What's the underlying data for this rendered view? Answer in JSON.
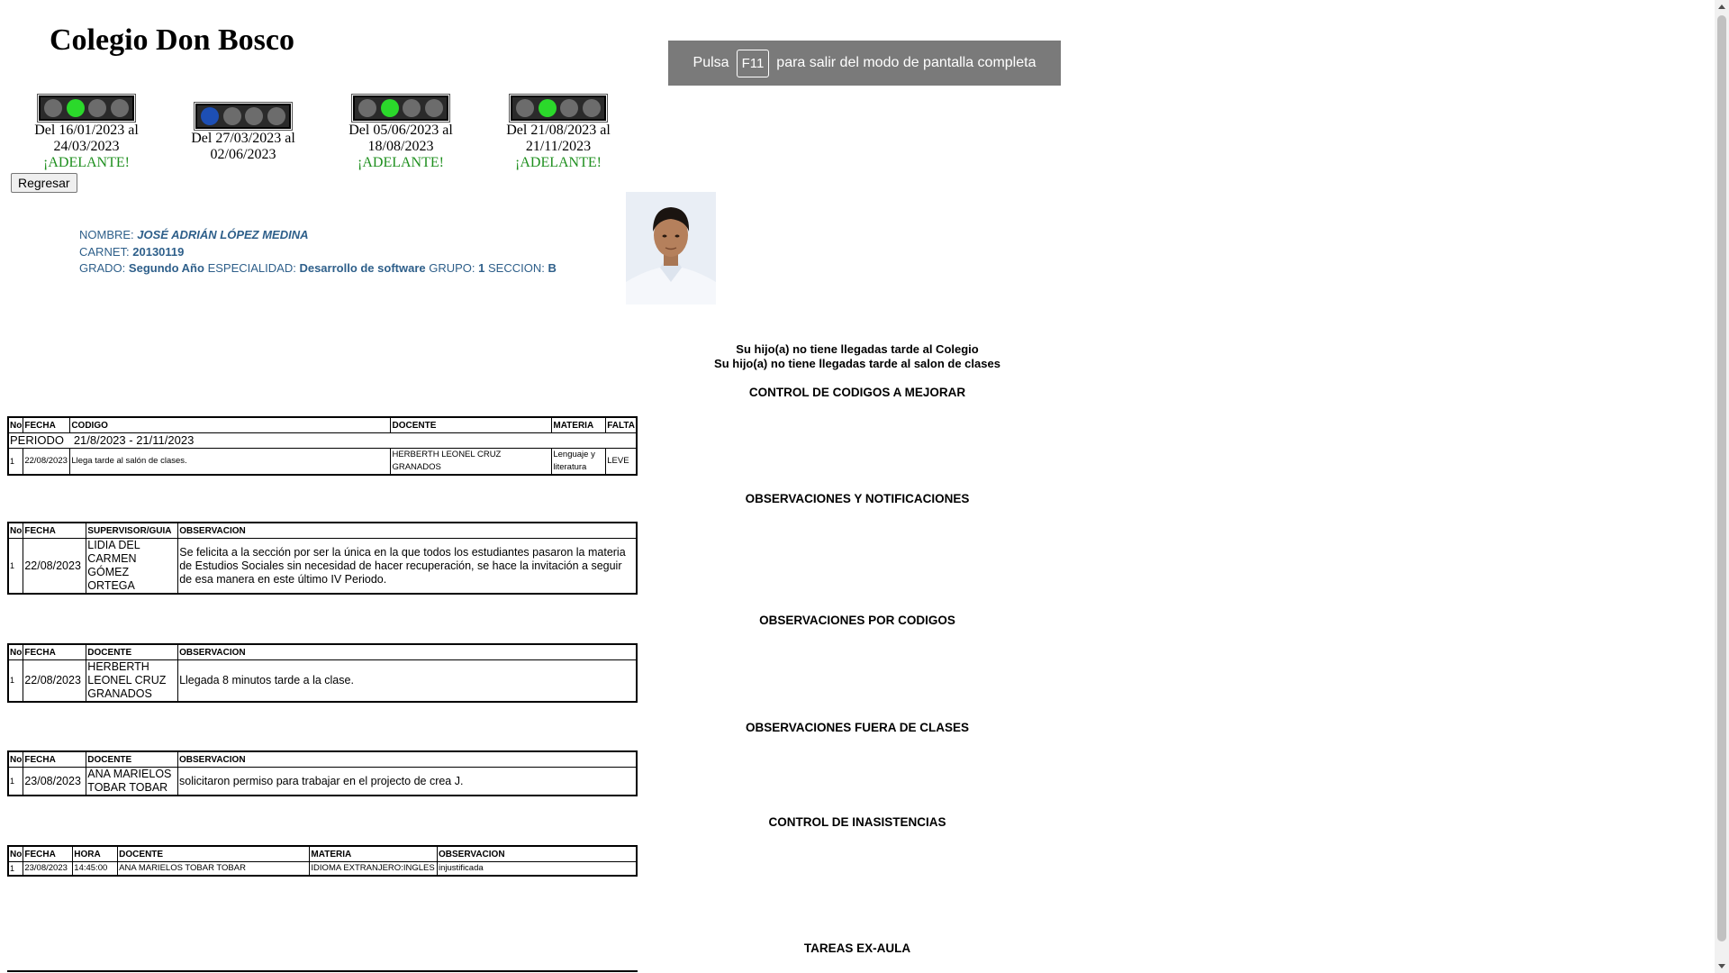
{
  "header": {
    "school_name": "Colegio Don Bosco"
  },
  "fullscreen_banner": {
    "prefix": "Pulsa",
    "key": "F11",
    "suffix": "para salir del modo de pantalla completa"
  },
  "periods": [
    {
      "text": "Del 16/01/2023 al 24/03/2023",
      "status": "¡ADELANTE!",
      "active_light": 2,
      "color": "green"
    },
    {
      "text": "Del 27/03/2023 al 02/06/2023",
      "status": "",
      "active_light": 1,
      "color": "blue"
    },
    {
      "text": "Del 05/06/2023 al 18/08/2023",
      "status": "¡ADELANTE!",
      "active_light": 2,
      "color": "green"
    },
    {
      "text": "Del 21/08/2023 al 21/11/2023",
      "status": "¡ADELANTE!",
      "active_light": 2,
      "color": "green"
    }
  ],
  "back_button": {
    "label": "Regresar"
  },
  "student": {
    "name_label": "NOMBRE:",
    "name": "JOSÉ ADRIÁN LÓPEZ MEDINA",
    "carnet_label": "CARNET:",
    "carnet": "20130119",
    "grado_label": "GRADO:",
    "grado": "Segundo Año",
    "especialidad_label": "ESPECIALIDAD:",
    "especialidad": "Desarrollo de software",
    "grupo_label": "GRUPO:",
    "grupo": "1",
    "seccion_label": "SECCION:",
    "seccion": "B"
  },
  "notices": {
    "late_school": "Su hijo(a) no tiene llegadas tarde al Colegio",
    "late_class": "Su hijo(a) no tiene llegadas tarde al salon de clases"
  },
  "codes": {
    "title": "CONTROL DE CODIGOS A MEJORAR",
    "headers": [
      "No",
      "FECHA",
      "CODIGO",
      "DOCENTE",
      "MATERIA",
      "FALTA"
    ],
    "period_label": "PERIODO",
    "period_value": "21/8/2023 - 21/11/2023",
    "rows": [
      {
        "no": "1",
        "fecha": "22/08/2023",
        "codigo": "Llega tarde al salón de clases.",
        "docente": "HERBERTH LEONEL CRUZ GRANADOS",
        "materia": "Lenguaje y literatura",
        "falta": "LEVE"
      }
    ]
  },
  "observaciones": {
    "title": "OBSERVACIONES Y NOTIFICACIONES",
    "headers": [
      "No",
      "FECHA",
      "SUPERVISOR/GUIA",
      "OBSERVACION"
    ],
    "rows": [
      {
        "no": "1",
        "fecha": "22/08/2023",
        "supervisor": "LIDIA DEL CARMEN GÓMEZ ORTEGA",
        "observacion": "Se felicita a la sección por ser la única en la que todos los estudiantes pasaron la materia de Estudios Sociales sin necesidad de hacer recuperación, se hace la invitación a seguir de esa manera en este último IV Periodo."
      }
    ]
  },
  "obs_codigos": {
    "title": "OBSERVACIONES POR CODIGOS",
    "headers": [
      "No",
      "FECHA",
      "DOCENTE",
      "OBSERVACION"
    ],
    "rows": [
      {
        "no": "1",
        "fecha": "22/08/2023",
        "docente": "HERBERTH LEONEL CRUZ GRANADOS",
        "observacion": "Llegada 8 minutos tarde a la clase."
      }
    ]
  },
  "obs_fuera": {
    "title": "OBSERVACIONES FUERA DE CLASES",
    "headers": [
      "No",
      "FECHA",
      "DOCENTE",
      "OBSERVACION"
    ],
    "rows": [
      {
        "no": "1",
        "fecha": "23/08/2023",
        "docente": "ANA MARIELOS TOBAR TOBAR",
        "observacion": "solicitaron permiso para trabajar en el projecto de crea J."
      }
    ]
  },
  "inasistencias": {
    "title": "CONTROL DE INASISTENCIAS",
    "headers": [
      "No",
      "FECHA",
      "HORA",
      "DOCENTE",
      "MATERIA",
      "OBSERVACION"
    ],
    "rows": [
      {
        "no": "1",
        "fecha": "23/08/2023",
        "hora": "14:45:00",
        "docente": "ANA MARIELOS TOBAR TOBAR",
        "materia": "IDIOMA EXTRANJERO:INGLES",
        "observacion": "injustificada"
      }
    ]
  },
  "tareas": {
    "title": "TAREAS EX-AULA"
  },
  "colors": {
    "accent_green": "#2bd92b",
    "accent_blue": "#1d4fb5",
    "student_text": "#2e5f8a",
    "banner_bg": "#7a7a7a"
  }
}
